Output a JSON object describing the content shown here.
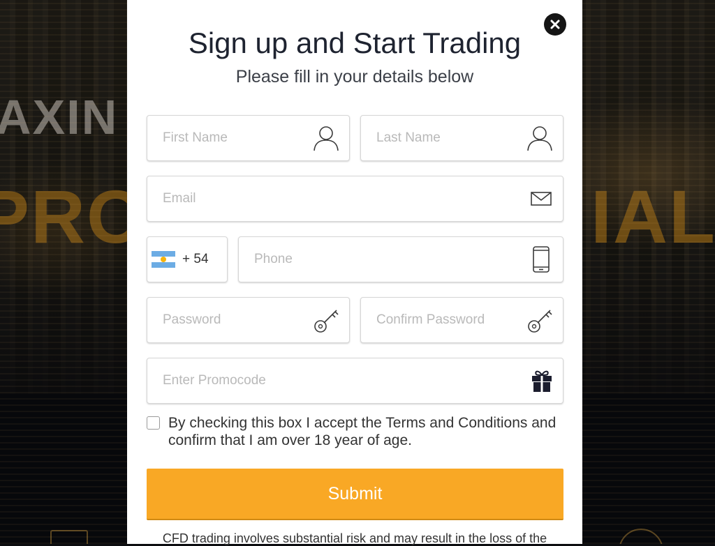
{
  "background": {
    "word_1": "AXIN",
    "word_2": "PRO",
    "word_3": "IAL"
  },
  "modal": {
    "title": "Sign up and Start Trading",
    "subtitle": "Please fill in your details below",
    "close_icon": "close-icon"
  },
  "form": {
    "first_name": {
      "placeholder": "First Name",
      "value": "",
      "icon": "user-icon"
    },
    "last_name": {
      "placeholder": "Last Name",
      "value": "",
      "icon": "user-icon"
    },
    "email": {
      "placeholder": "Email",
      "value": "",
      "icon": "envelope-icon"
    },
    "country_code": {
      "value": "+ 54",
      "flag": "argentina-flag-icon"
    },
    "phone": {
      "placeholder": "Phone",
      "value": "",
      "icon": "mobile-phone-icon"
    },
    "password": {
      "placeholder": "Password",
      "value": "",
      "icon": "key-icon"
    },
    "confirm_password": {
      "placeholder": "Confirm Password",
      "value": "",
      "icon": "key-icon"
    },
    "promocode": {
      "placeholder": "Enter Promocode",
      "value": "",
      "icon": "gift-icon"
    },
    "terms": {
      "checked": false,
      "label": "By checking this box I accept the Terms and Conditions and confirm that I am over 18 year of age."
    },
    "submit_label": "Submit"
  },
  "disclaimer": "CFD trading involves substantial risk and may result in the loss of the",
  "colors": {
    "accent": "#f9a825",
    "title_text": "#1e2330",
    "placeholder": "#b9b9b9"
  }
}
